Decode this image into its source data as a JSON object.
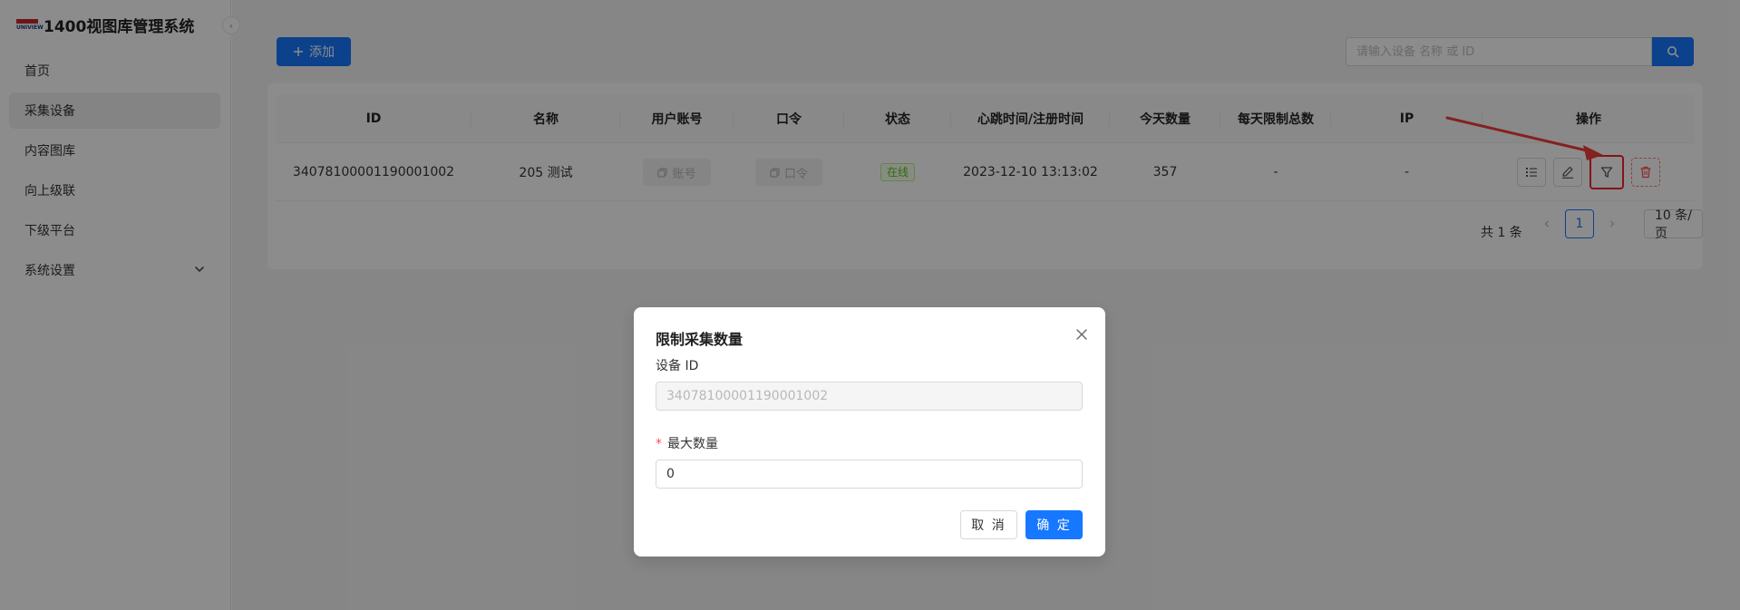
{
  "app": {
    "logo_text": "UNIVIEW",
    "title": "1400视图库管理系统"
  },
  "sidebar": {
    "items": [
      {
        "label": "首页"
      },
      {
        "label": "采集设备",
        "active": true
      },
      {
        "label": "内容图库"
      },
      {
        "label": "向上级联"
      },
      {
        "label": "下级平台"
      },
      {
        "label": "系统设置",
        "has_submenu": true
      }
    ]
  },
  "toolbar": {
    "add_label": "添加",
    "search_placeholder": "请输入设备 名称 或 ID"
  },
  "table": {
    "columns": [
      "ID",
      "名称",
      "用户账号",
      "口令",
      "状态",
      "心跳时间/注册时间",
      "今天数量",
      "每天限制总数",
      "IP",
      "操作"
    ],
    "rows": [
      {
        "id": "34078100001190001002",
        "name": "205 测试",
        "account_btn": "账号",
        "password_btn": "口令",
        "status": "在线",
        "heartbeat": "2023-12-10 13:13:02",
        "today_count": "357",
        "daily_limit": "-",
        "ip": "-"
      }
    ]
  },
  "pagination": {
    "total": "共 1 条",
    "current": "1",
    "page_size": "10 条/页"
  },
  "modal": {
    "title": "限制采集数量",
    "device_id_label": "设备 ID",
    "device_id_value": "34078100001190001002",
    "required_mark": "*",
    "max_label": "最大数量",
    "max_value": "0",
    "cancel_label": "取 消",
    "ok_label": "确 定"
  },
  "colors": {
    "primary": "#1677ff",
    "danger": "#f5222d",
    "online": "#52c41a",
    "annotation": "#f03c3c"
  }
}
